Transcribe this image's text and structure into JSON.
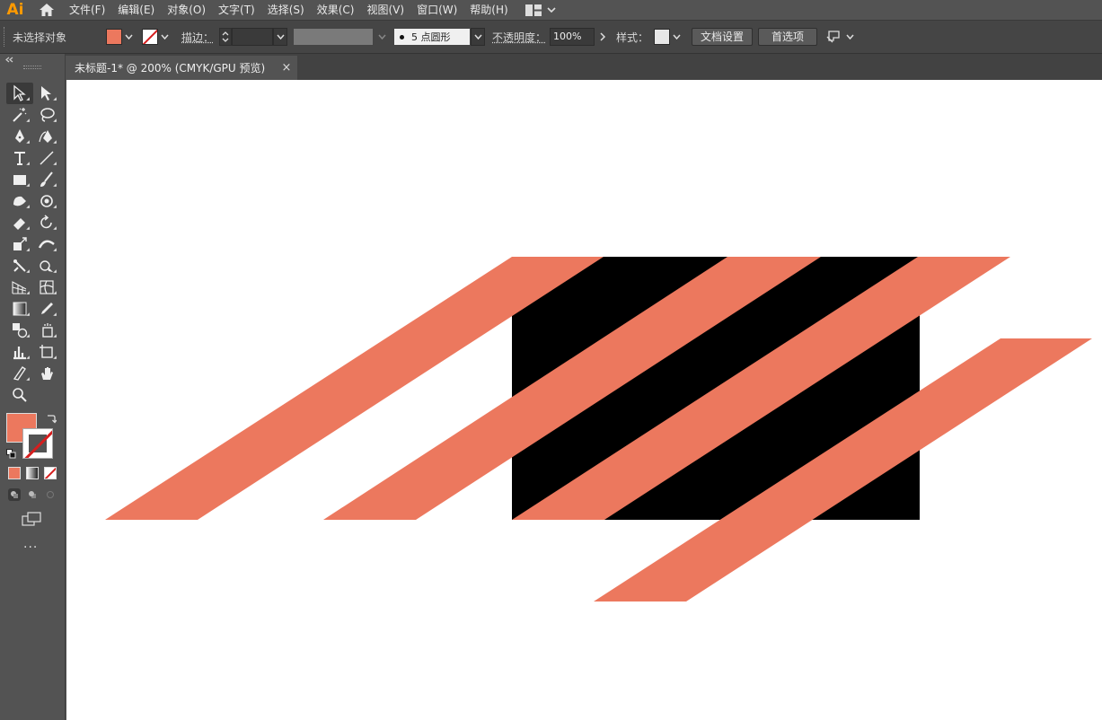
{
  "app": {
    "logo": "Ai"
  },
  "menu": [
    "文件(F)",
    "编辑(E)",
    "对象(O)",
    "文字(T)",
    "选择(S)",
    "效果(C)",
    "视图(V)",
    "窗口(W)",
    "帮助(H)"
  ],
  "control_bar": {
    "selection_status": "未选择对象",
    "fill_color": "#ec785e",
    "stroke_label": "描边：",
    "brush_value": "5 点圆形",
    "opacity_label": "不透明度：",
    "opacity_value": "100%",
    "style_label": "样式：",
    "doc_setup_button": "文档设置",
    "preferences_button": "首选项"
  },
  "document_tab": {
    "title": "未标题-1* @ 200% (CMYK/GPU 预览)",
    "close": "×"
  },
  "toolbar": {
    "tools": [
      [
        "selection-tool",
        "direct-selection-tool"
      ],
      [
        "magic-wand-tool",
        "lasso-tool"
      ],
      [
        "pen-tool",
        "curvature-tool"
      ],
      [
        "type-tool",
        "line-segment-tool"
      ],
      [
        "rectangle-tool",
        "paintbrush-tool"
      ],
      [
        "shaper-tool",
        "blob-brush-tool"
      ],
      [
        "eraser-tool",
        "rotate-tool"
      ],
      [
        "scale-tool",
        "width-tool"
      ],
      [
        "free-transform-tool",
        "shape-builder-tool"
      ],
      [
        "perspective-grid-tool",
        "mesh-tool"
      ],
      [
        "gradient-tool",
        "eyedropper-tool"
      ],
      [
        "blend-tool",
        "symbol-sprayer-tool"
      ],
      [
        "column-graph-tool",
        "artboard-tool"
      ],
      [
        "slice-tool",
        "hand-tool"
      ],
      [
        "zoom-tool",
        ""
      ]
    ],
    "fill_color": "#ec785e",
    "more": "..."
  },
  "artwork": {
    "stripe_color": "#ec785e",
    "rect_color": "#000000"
  }
}
